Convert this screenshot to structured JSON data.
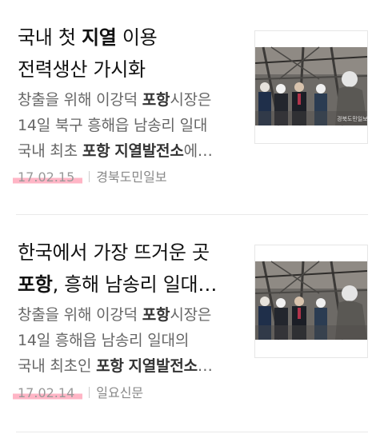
{
  "articles": [
    {
      "title_parts": [
        "국내 첫 ",
        "지열",
        " 이용",
        "전력생산 가시화"
      ],
      "summary_parts": [
        "창출을 위해 이강덕 ",
        "포항",
        "시장은",
        "14일 북구 흥해읍 남송리 일대",
        "국내 최초 ",
        "포항",
        " ",
        "지열발전소",
        "에…"
      ],
      "date": "17.02.15",
      "source": "경북도민일보",
      "thumb_icon": "news-photo-geothermal-plant",
      "photo_credit": "경북도민일보"
    },
    {
      "title_parts": [
        "한국에서 가장 뜨거운 곳",
        "포항",
        ", 흥해 남송리 일대…"
      ],
      "summary_parts": [
        "창출을 위해 이강덕 ",
        "포항",
        "시장은",
        "14일 흥해읍 남송리 일대의",
        "국내 최초인 ",
        "포항",
        " ",
        "지열발전소",
        "…"
      ],
      "date": "17.02.14",
      "source": "일요신문",
      "thumb_icon": "news-photo-geothermal-plant"
    }
  ],
  "colors": {
    "date_highlight": "#ff7896",
    "summary_text": "#666666",
    "meta_text": "#888888"
  }
}
